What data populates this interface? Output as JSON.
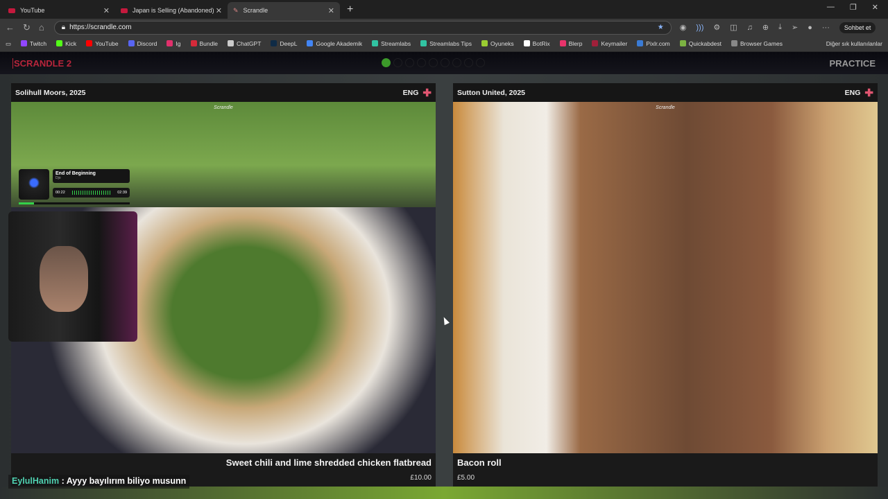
{
  "browser": {
    "tabs": [
      {
        "label": "YouTube"
      },
      {
        "label": "Japan is Selling (Abandoned) Hou"
      },
      {
        "label": "Scrandle",
        "active": true
      }
    ],
    "url": "https://scrandle.com",
    "copilot_label": "Sohbet et",
    "bookmarks": [
      {
        "label": "Twitch",
        "color": "#9146ff"
      },
      {
        "label": "Kick",
        "color": "#53fc18"
      },
      {
        "label": "YouTube",
        "color": "#ff0000"
      },
      {
        "label": "Discord",
        "color": "#5865f2"
      },
      {
        "label": "Ig",
        "color": "#e1306c"
      },
      {
        "label": "Bundle",
        "color": "#d62a3a"
      },
      {
        "label": "ChatGPT",
        "color": "#cccccc"
      },
      {
        "label": "DeepL",
        "color": "#0f2b46"
      },
      {
        "label": "Google Akademik",
        "color": "#4285f4"
      },
      {
        "label": "Streamlabs",
        "color": "#31c3a2"
      },
      {
        "label": "Streamlabs Tips",
        "color": "#31c3a2"
      },
      {
        "label": "Oyuneks",
        "color": "#9acd32"
      },
      {
        "label": "BotRix",
        "color": "#ffffff"
      },
      {
        "label": "Blerp",
        "color": "#e8336b"
      },
      {
        "label": "Keymailer",
        "color": "#a0203a"
      },
      {
        "label": "Pixlr.com",
        "color": "#3a7bd5"
      },
      {
        "label": "Quickabdest",
        "color": "#7cb342"
      },
      {
        "label": "Browser Games",
        "color": "#888888"
      }
    ],
    "other_bookmarks": "Diğer sık kullanılanlar"
  },
  "app": {
    "brand": "SCRANDLE 2",
    "mode": "PRACTICE",
    "progress": {
      "completed": 1,
      "total": 9
    },
    "accent": "#b8253b"
  },
  "cards": [
    {
      "club": "Solihull Moors, 2025",
      "country": "ENG",
      "watermark": "Scrandle",
      "dish": "Sweet chili and lime shredded chicken flatbread",
      "price": "£10.00"
    },
    {
      "club": "Sutton United, 2025",
      "country": "ENG",
      "watermark": "Scrandle",
      "dish": "Bacon roll",
      "price": "£5.00"
    }
  ],
  "overlay": {
    "music": {
      "title": "End of Beginning",
      "artist": "Djo",
      "elapsed": "00:22",
      "duration": "02:39",
      "progress_fraction": 0.14
    },
    "chat": {
      "user": "EylulHanim",
      "message": ": Ayyy bayılırım biliyo musunn"
    }
  }
}
